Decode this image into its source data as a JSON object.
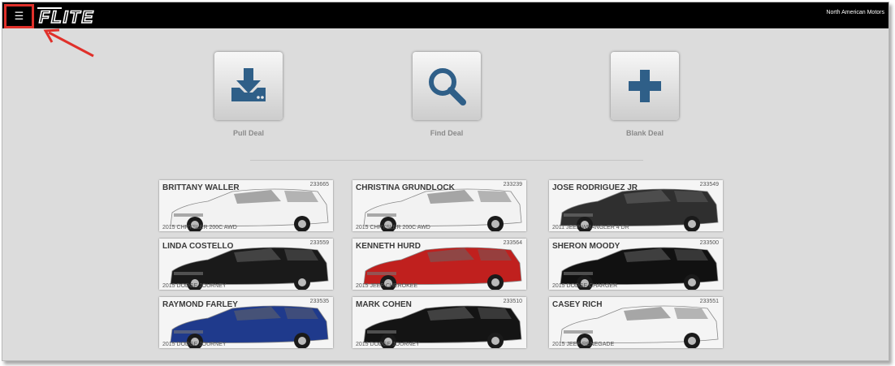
{
  "header": {
    "menu_icon": "hamburger-icon",
    "logo_text": "FLITE",
    "company": "North American Motors"
  },
  "actions": [
    {
      "label": "Pull Deal",
      "icon": "download-icon"
    },
    {
      "label": "Find Deal",
      "icon": "search-icon"
    },
    {
      "label": "Blank Deal",
      "icon": "plus-icon"
    }
  ],
  "deals": [
    {
      "name": "BRITTANY WALLER",
      "number": "233665",
      "vehicle": "2015 CHRYSLER 200C AWD",
      "color": "#f2f2f2"
    },
    {
      "name": "CHRISTINA GRUNDLOCK",
      "number": "233239",
      "vehicle": "2015 CHRYSLER 200C AWD",
      "color": "#f2f2f2"
    },
    {
      "name": "JOSE RODRIGUEZ JR",
      "number": "233549",
      "vehicle": "2011 JEEP WRANGLER 4 DR",
      "color": "#2f2f2f"
    },
    {
      "name": "LINDA COSTELLO",
      "number": "233559",
      "vehicle": "2015 DODGE JOURNEY",
      "color": "#1a1a1a"
    },
    {
      "name": "KENNETH HURD",
      "number": "233564",
      "vehicle": "2015 JEEP CHEROKEE",
      "color": "#c0201e"
    },
    {
      "name": "SHERON MOODY",
      "number": "233500",
      "vehicle": "2015 DODGE CHARGER",
      "color": "#111111"
    },
    {
      "name": "RAYMOND FARLEY",
      "number": "233535",
      "vehicle": "2015 DODGE JOURNEY",
      "color": "#1f3a8c"
    },
    {
      "name": "MARK COHEN",
      "number": "233510",
      "vehicle": "2015 DODGE JOURNEY",
      "color": "#141414"
    },
    {
      "name": "CASEY RICH",
      "number": "233551",
      "vehicle": "2015 JEEP RENEGADE",
      "color": "#f4f4f4"
    }
  ]
}
